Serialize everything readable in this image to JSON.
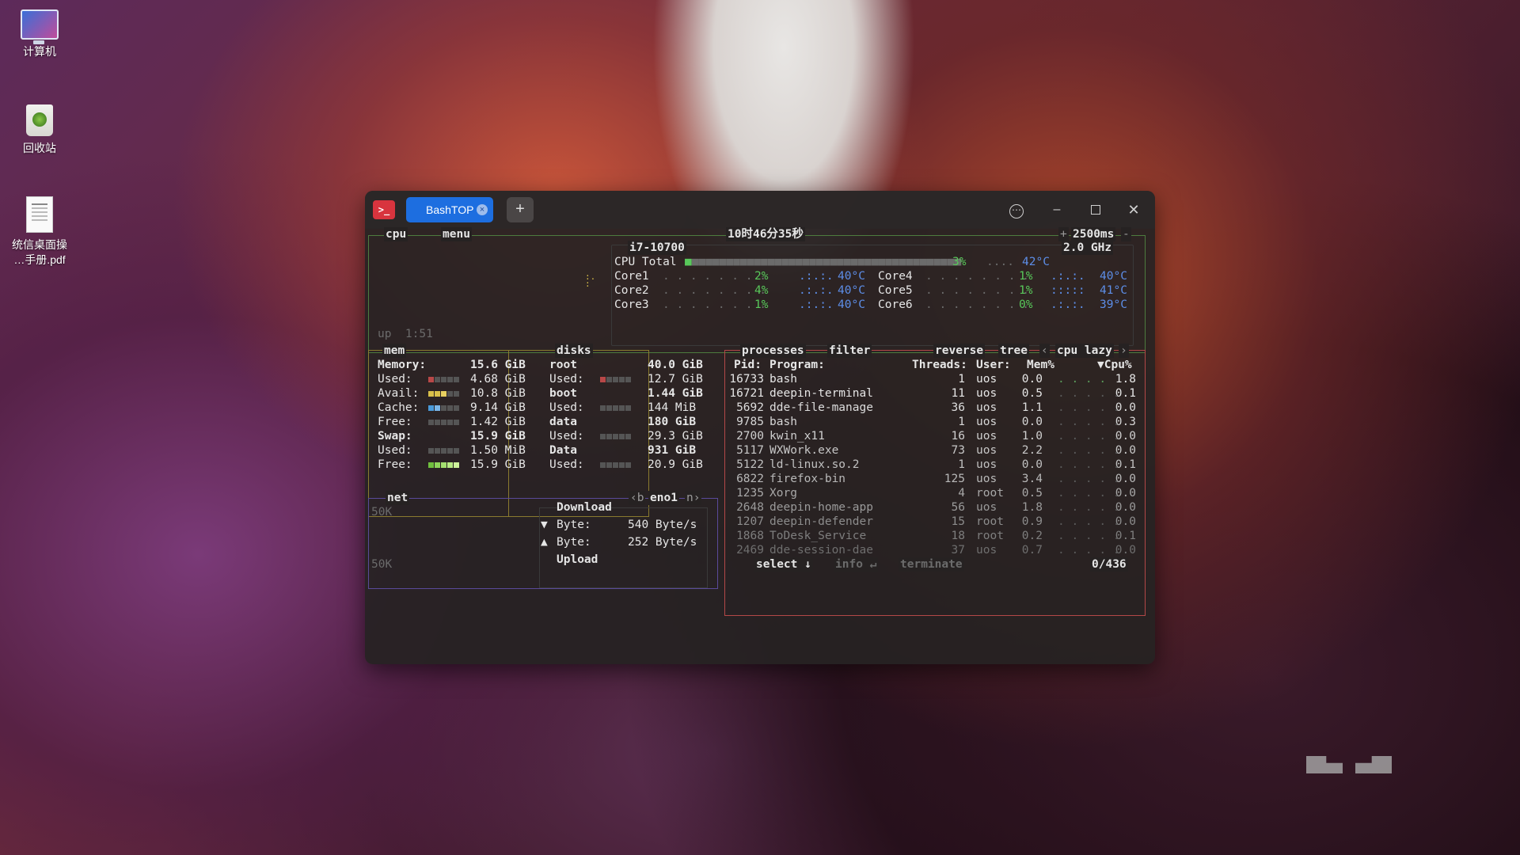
{
  "desktop": {
    "icons": [
      {
        "label": "计算机",
        "icon": "computer-icon"
      },
      {
        "label": "回收站",
        "icon": "trash-icon"
      },
      {
        "label_line1": "统信桌面操",
        "label_line2": "…手册.pdf",
        "icon": "pdf-file-icon"
      }
    ]
  },
  "window": {
    "tab_title": "BashTOP",
    "new_tab": "+",
    "controls": {
      "more": "⋯",
      "minimize": "–",
      "close": "✕"
    }
  },
  "cpu": {
    "title": "cpu",
    "menu": "menu",
    "clock": "10时46分35秒",
    "update_interval": "2500ms",
    "interval_plus": "+",
    "interval_minus": "-",
    "model": "i7-10700",
    "freq": "2.0 GHz",
    "uptime": "up  1:51",
    "total_label": "CPU Total",
    "total_pct": "3%",
    "total_temp": "42°C",
    "cores": [
      {
        "name": "Core1",
        "pct": "2%",
        "temp": "40°C"
      },
      {
        "name": "Core2",
        "pct": "4%",
        "temp": "40°C"
      },
      {
        "name": "Core3",
        "pct": "1%",
        "temp": "40°C"
      },
      {
        "name": "Core4",
        "pct": "1%",
        "temp": "40°C"
      },
      {
        "name": "Core5",
        "pct": "1%",
        "temp": "41°C"
      },
      {
        "name": "Core6",
        "pct": "0%",
        "temp": "39°C"
      }
    ]
  },
  "mem": {
    "title": "mem",
    "rows": [
      {
        "label": "Memory:",
        "value": "15.6 GiB"
      },
      {
        "label": "Used:",
        "value": "4.68 GiB",
        "color": "#b84848",
        "level": 0.3
      },
      {
        "label": "Avail:",
        "value": "10.8 GiB",
        "color": "#d9c04a",
        "level": 0.7
      },
      {
        "label": "Cache:",
        "value": "9.14 GiB",
        "color": "#4a9ad9",
        "level": 0.6
      },
      {
        "label": "Free:",
        "value": "1.42 GiB",
        "color": "#777777",
        "level": 0.1
      },
      {
        "label": "Swap:",
        "value": "15.9 GiB"
      },
      {
        "label": "Used:",
        "value": "1.50 MiB",
        "color": "#777777",
        "level": 0.0
      },
      {
        "label": "Free:",
        "value": "15.9 GiB",
        "color": "#8ed45a",
        "level": 1.0
      }
    ]
  },
  "disks": {
    "title": "disks",
    "rows": [
      {
        "label": "root",
        "value": "40.0 GiB"
      },
      {
        "label": "Used:",
        "value": "12.7 GiB",
        "color": "#b84848",
        "level": 0.32
      },
      {
        "label": "boot",
        "value": "1.44 GiB"
      },
      {
        "label": "Used:",
        "value": "144 MiB",
        "color": "#777777",
        "level": 0.1
      },
      {
        "label": "data",
        "value": "180 GiB"
      },
      {
        "label": "Used:",
        "value": "29.3 GiB",
        "color": "#777777",
        "level": 0.16
      },
      {
        "label": "Data",
        "value": "931 GiB"
      },
      {
        "label": "Used:",
        "value": "20.9 GiB",
        "color": "#777777",
        "level": 0.02
      }
    ]
  },
  "net": {
    "title": "net",
    "interface": "eno1",
    "prev_key": "‹b",
    "next_key": "n›",
    "scale_top": "50K",
    "scale_bottom": "50K",
    "download_label": "Download",
    "upload_label": "Upload",
    "down_row": {
      "arrow": "▼",
      "label": "Byte:",
      "value": "540 Byte/s"
    },
    "up_row": {
      "arrow": "▲",
      "label": "Byte:",
      "value": "252 Byte/s"
    }
  },
  "processes": {
    "title": "processes",
    "filter": "filter",
    "reverse": "reverse",
    "tree": "tree",
    "sort": "cpu lazy",
    "sort_prev": "‹",
    "sort_next": "›",
    "columns": {
      "pid": "Pid:",
      "program": "Program:",
      "threads": "Threads:",
      "user": "User:",
      "mem": "Mem%",
      "cpu": "▼Cpu%"
    },
    "rows": [
      {
        "pid": "16733",
        "program": "bash",
        "threads": "1",
        "user": "uos",
        "mem": "0.0",
        "cpu": "1.8"
      },
      {
        "pid": "16721",
        "program": "deepin-terminal",
        "threads": "11",
        "user": "uos",
        "mem": "0.5",
        "cpu": "0.1"
      },
      {
        "pid": "5692",
        "program": "dde-file-manage",
        "threads": "36",
        "user": "uos",
        "mem": "1.1",
        "cpu": "0.0"
      },
      {
        "pid": "9785",
        "program": "bash",
        "threads": "1",
        "user": "uos",
        "mem": "0.0",
        "cpu": "0.3"
      },
      {
        "pid": "2700",
        "program": "kwin_x11",
        "threads": "16",
        "user": "uos",
        "mem": "1.0",
        "cpu": "0.0"
      },
      {
        "pid": "5117",
        "program": "WXWork.exe",
        "threads": "73",
        "user": "uos",
        "mem": "2.2",
        "cpu": "0.0"
      },
      {
        "pid": "5122",
        "program": "ld-linux.so.2",
        "threads": "1",
        "user": "uos",
        "mem": "0.0",
        "cpu": "0.1"
      },
      {
        "pid": "6822",
        "program": "firefox-bin",
        "threads": "125",
        "user": "uos",
        "mem": "3.4",
        "cpu": "0.0"
      },
      {
        "pid": "1235",
        "program": "Xorg",
        "threads": "4",
        "user": "root",
        "mem": "0.5",
        "cpu": "0.0"
      },
      {
        "pid": "2648",
        "program": "deepin-home-app",
        "threads": "56",
        "user": "uos",
        "mem": "1.8",
        "cpu": "0.0"
      },
      {
        "pid": "1207",
        "program": "deepin-defender",
        "threads": "15",
        "user": "root",
        "mem": "0.9",
        "cpu": "0.0"
      },
      {
        "pid": "1868",
        "program": "ToDesk_Service",
        "threads": "18",
        "user": "root",
        "mem": "0.2",
        "cpu": "0.1"
      },
      {
        "pid": "2469",
        "program": "dde-session-dae",
        "threads": "37",
        "user": "uos",
        "mem": "0.7",
        "cpu": "0.0"
      }
    ],
    "footer": {
      "select": "select ↓",
      "info": "info ↵",
      "terminate": "terminate",
      "count": "0/436"
    }
  }
}
